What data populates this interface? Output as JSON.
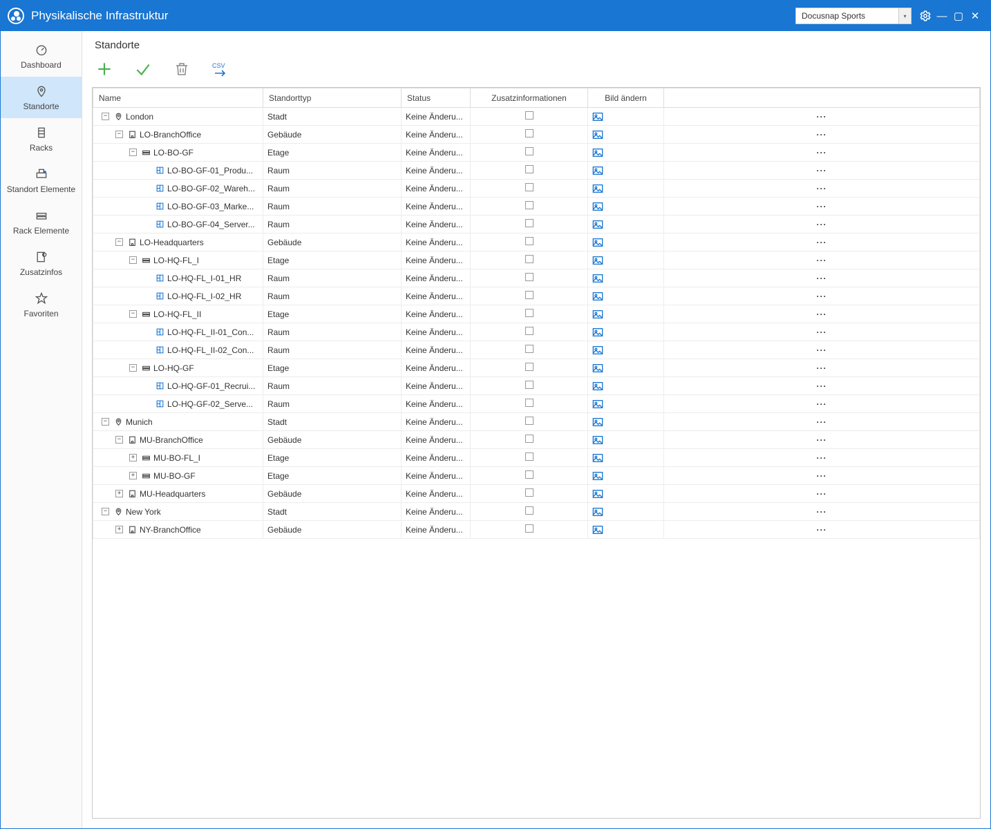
{
  "titlebar": {
    "title": "Physikalische Infrastruktur",
    "tenant": "Docusnap Sports"
  },
  "sidebar": [
    {
      "label": "Dashboard",
      "icon": "gauge"
    },
    {
      "label": "Standorte",
      "icon": "pin",
      "active": true
    },
    {
      "label": "Racks",
      "icon": "rack"
    },
    {
      "label": "Standort Elemente",
      "icon": "elements"
    },
    {
      "label": "Rack Elemente",
      "icon": "rackelem"
    },
    {
      "label": "Zusatzinfos",
      "icon": "info"
    },
    {
      "label": "Favoriten",
      "icon": "star"
    }
  ],
  "page": {
    "heading": "Standorte"
  },
  "columns": {
    "name": "Name",
    "type": "Standorttyp",
    "status": "Status",
    "zusatz": "Zusatzinformationen",
    "bild": "Bild ändern"
  },
  "status_text": "Keine Änderu...",
  "types": {
    "city": "Stadt",
    "building": "Gebäude",
    "floor": "Etage",
    "room": "Raum"
  },
  "rows": [
    {
      "indent": 0,
      "toggle": "-",
      "icon": "pin",
      "name": "London",
      "type": "city"
    },
    {
      "indent": 1,
      "toggle": "-",
      "icon": "building",
      "name": "LO-BranchOffice",
      "type": "building"
    },
    {
      "indent": 2,
      "toggle": "-",
      "icon": "floor",
      "name": "LO-BO-GF",
      "type": "floor"
    },
    {
      "indent": 3,
      "toggle": "",
      "icon": "room",
      "name": "LO-BO-GF-01_Produ...",
      "type": "room"
    },
    {
      "indent": 3,
      "toggle": "",
      "icon": "room",
      "name": "LO-BO-GF-02_Wareh...",
      "type": "room"
    },
    {
      "indent": 3,
      "toggle": "",
      "icon": "room",
      "name": "LO-BO-GF-03_Marke...",
      "type": "room"
    },
    {
      "indent": 3,
      "toggle": "",
      "icon": "room",
      "name": "LO-BO-GF-04_Server...",
      "type": "room"
    },
    {
      "indent": 1,
      "toggle": "-",
      "icon": "building",
      "name": "LO-Headquarters",
      "type": "building"
    },
    {
      "indent": 2,
      "toggle": "-",
      "icon": "floor",
      "name": "LO-HQ-FL_I",
      "type": "floor"
    },
    {
      "indent": 3,
      "toggle": "",
      "icon": "room",
      "name": "LO-HQ-FL_I-01_HR",
      "type": "room"
    },
    {
      "indent": 3,
      "toggle": "",
      "icon": "room",
      "name": "LO-HQ-FL_I-02_HR",
      "type": "room"
    },
    {
      "indent": 2,
      "toggle": "-",
      "icon": "floor",
      "name": "LO-HQ-FL_II",
      "type": "floor"
    },
    {
      "indent": 3,
      "toggle": "",
      "icon": "room",
      "name": "LO-HQ-FL_II-01_Con...",
      "type": "room"
    },
    {
      "indent": 3,
      "toggle": "",
      "icon": "room",
      "name": "LO-HQ-FL_II-02_Con...",
      "type": "room"
    },
    {
      "indent": 2,
      "toggle": "-",
      "icon": "floor",
      "name": "LO-HQ-GF",
      "type": "floor"
    },
    {
      "indent": 3,
      "toggle": "",
      "icon": "room",
      "name": "LO-HQ-GF-01_Recrui...",
      "type": "room"
    },
    {
      "indent": 3,
      "toggle": "",
      "icon": "room",
      "name": "LO-HQ-GF-02_Serve...",
      "type": "room"
    },
    {
      "indent": 0,
      "toggle": "-",
      "icon": "pin",
      "name": "Munich",
      "type": "city"
    },
    {
      "indent": 1,
      "toggle": "-",
      "icon": "building",
      "name": "MU-BranchOffice",
      "type": "building",
      "selected": true
    },
    {
      "indent": 2,
      "toggle": "+",
      "icon": "floor",
      "name": "MU-BO-FL_I",
      "type": "floor"
    },
    {
      "indent": 2,
      "toggle": "+",
      "icon": "floor",
      "name": "MU-BO-GF",
      "type": "floor"
    },
    {
      "indent": 1,
      "toggle": "+",
      "icon": "building",
      "name": "MU-Headquarters",
      "type": "building"
    },
    {
      "indent": 0,
      "toggle": "-",
      "icon": "pin",
      "name": "New York",
      "type": "city"
    },
    {
      "indent": 1,
      "toggle": "+",
      "icon": "building",
      "name": "NY-BranchOffice",
      "type": "building"
    }
  ]
}
